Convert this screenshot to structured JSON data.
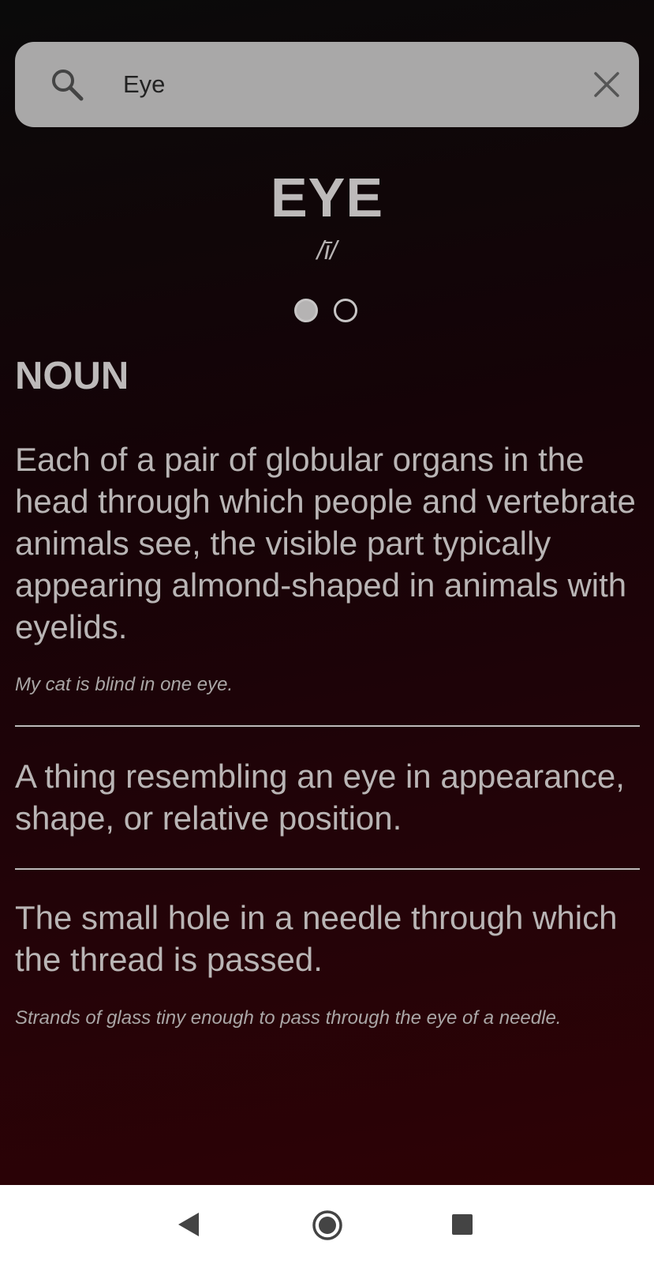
{
  "search": {
    "query": "Eye",
    "search_icon": "search-icon",
    "clear_icon": "close-icon"
  },
  "entry": {
    "word": "EYE",
    "pronunciation": "/ī/",
    "page_indicator": {
      "current": 1,
      "total": 2
    },
    "part_of_speech": "NOUN",
    "senses": [
      {
        "definition": "Each of a pair of globular organs in the head through which people and vertebrate animals see, the visible part typically appearing almond-shaped in animals with eyelids.",
        "example": "My cat is blind in one eye."
      },
      {
        "definition": "A thing resembling an eye in appearance, shape, or relative position."
      },
      {
        "definition": "The small hole in a needle through which the thread is passed.",
        "example": "Strands of glass tiny enough to pass through the eye of a needle."
      }
    ]
  },
  "nav_bar": {
    "back_icon": "back-triangle-icon",
    "home_icon": "home-circle-icon",
    "recents_icon": "recents-square-icon"
  },
  "colors": {
    "background_top": "#0a0a0a",
    "background_bottom": "#300204",
    "search_bar": "#a9a8a8",
    "text": "#b7b3b3"
  }
}
